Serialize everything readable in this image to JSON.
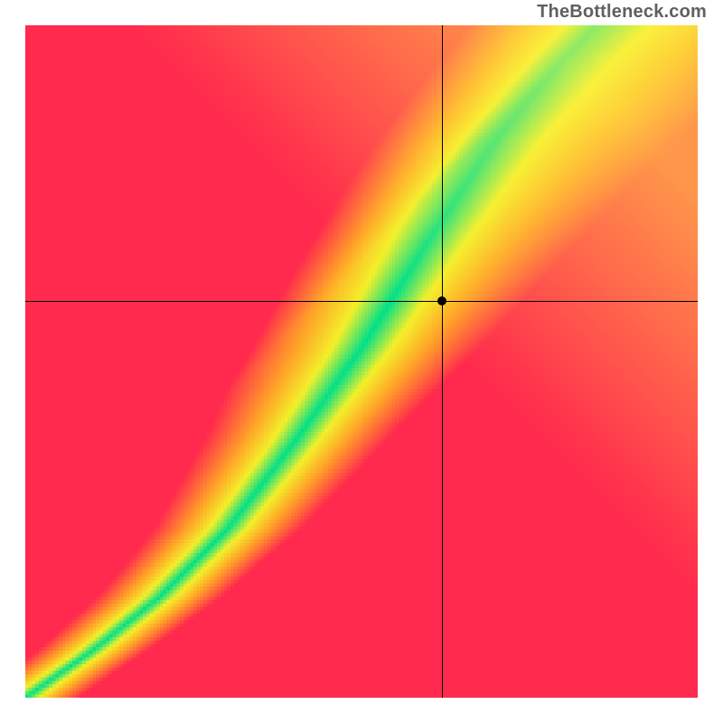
{
  "watermark": "TheBottleneck.com",
  "chart_data": {
    "type": "heatmap",
    "title": "",
    "xlabel": "",
    "ylabel": "",
    "xlim": [
      0,
      1
    ],
    "ylim": [
      0,
      1
    ],
    "crosshair": {
      "x": 0.62,
      "y": 0.59
    },
    "ridge": [
      {
        "x": 0.0,
        "y": 0.0
      },
      {
        "x": 0.1,
        "y": 0.07
      },
      {
        "x": 0.2,
        "y": 0.15
      },
      {
        "x": 0.3,
        "y": 0.25
      },
      {
        "x": 0.4,
        "y": 0.38
      },
      {
        "x": 0.5,
        "y": 0.52
      },
      {
        "x": 0.6,
        "y": 0.68
      },
      {
        "x": 0.7,
        "y": 0.83
      },
      {
        "x": 0.8,
        "y": 0.95
      },
      {
        "x": 0.85,
        "y": 1.0
      }
    ],
    "band_half_width_at_y": [
      {
        "y": 0.05,
        "w": 0.015
      },
      {
        "y": 0.2,
        "w": 0.02
      },
      {
        "y": 0.4,
        "w": 0.03
      },
      {
        "y": 0.6,
        "w": 0.045
      },
      {
        "y": 0.8,
        "w": 0.06
      },
      {
        "y": 1.0,
        "w": 0.075
      }
    ],
    "colors": {
      "optimal": "#00e08a",
      "near": "#f4f02a",
      "mid": "#ffa428",
      "far": "#ff2a4d",
      "corner_tr": "#fff24a"
    }
  }
}
